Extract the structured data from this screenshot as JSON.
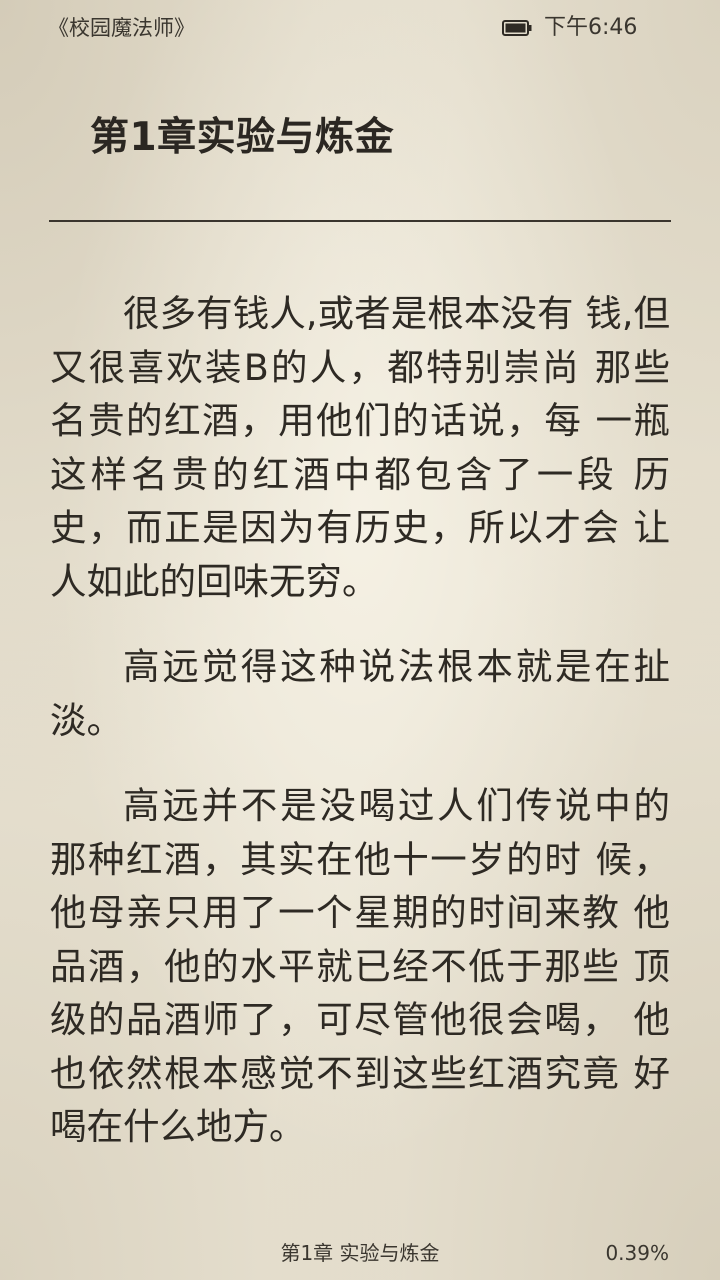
{
  "status_bar": {
    "book_title": "《校园魔法师》",
    "time": "下午6:46",
    "battery_icon": "battery-full-icon"
  },
  "chapter": {
    "title": "第1章实验与炼金"
  },
  "paragraphs": [
    "很多有钱人,或者是根本没有 钱,但又很喜欢装B的人，都特别崇尚 那些名贵的红酒，用他们的话说，每 一瓶这样名贵的红酒中都包含了一段 历史，而正是因为有历史，所以才会 让人如此的回味无穷。",
    "高远觉得这种说法根本就是在扯淡。",
    "高远并不是没喝过人们传说中的那种红酒，其实在他十一岁的时 候，他母亲只用了一个星期的时间来教 他品酒，他的水平就已经不低于那些 顶级的品酒师了，可尽管他很会喝， 他也依然根本感觉不到这些红酒究竟 好喝在什么地方。"
  ],
  "footer": {
    "chapter_label": "第1章 实验与炼金",
    "progress": "0.39%"
  }
}
